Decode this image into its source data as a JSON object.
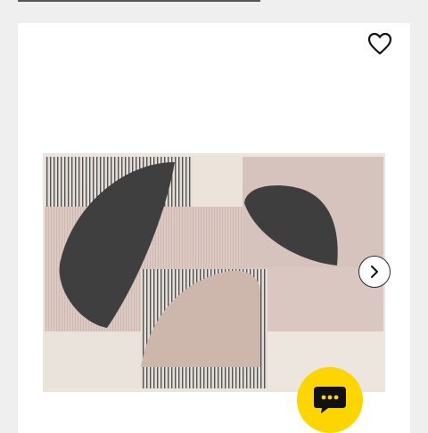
{
  "page": {
    "background_color": "#efefef",
    "card_color": "#ffffff"
  },
  "product_gallery": {
    "image_alt": "",
    "favourite_icon": "heart-outline-icon",
    "next_icon": "chevron-right-icon"
  },
  "chat": {
    "icon": "chat-bubble-icon",
    "accent_color": "#ffd500"
  }
}
